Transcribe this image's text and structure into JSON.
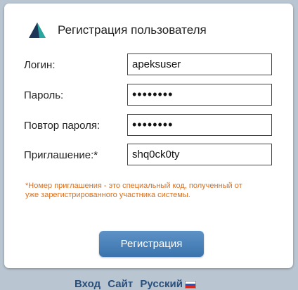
{
  "header": {
    "title": "Регистрация пользователя",
    "logo_icon": "apeks-triangle-logo"
  },
  "form": {
    "login": {
      "label": "Логин:",
      "value": "apeksuser"
    },
    "password": {
      "label": "Пароль:",
      "value": "••••••••"
    },
    "password_repeat": {
      "label": "Повтор пароля:",
      "value": "••••••••"
    },
    "invite": {
      "label": "Приглашение:*",
      "value": "shq0ck0ty"
    }
  },
  "note": "*Номер приглашения - это специальный код, полученный от уже зарегистрированного участника системы.",
  "submit_label": "Регистрация",
  "footer": {
    "login_link": "Вход",
    "site_link": "Сайт",
    "language": "Русский",
    "language_flag_icon": "russia-flag-icon"
  },
  "colors": {
    "accent": "#3a73ad",
    "note": "#d9701e",
    "logo_dark": "#1d3557",
    "logo_teal": "#2aa6a0"
  }
}
